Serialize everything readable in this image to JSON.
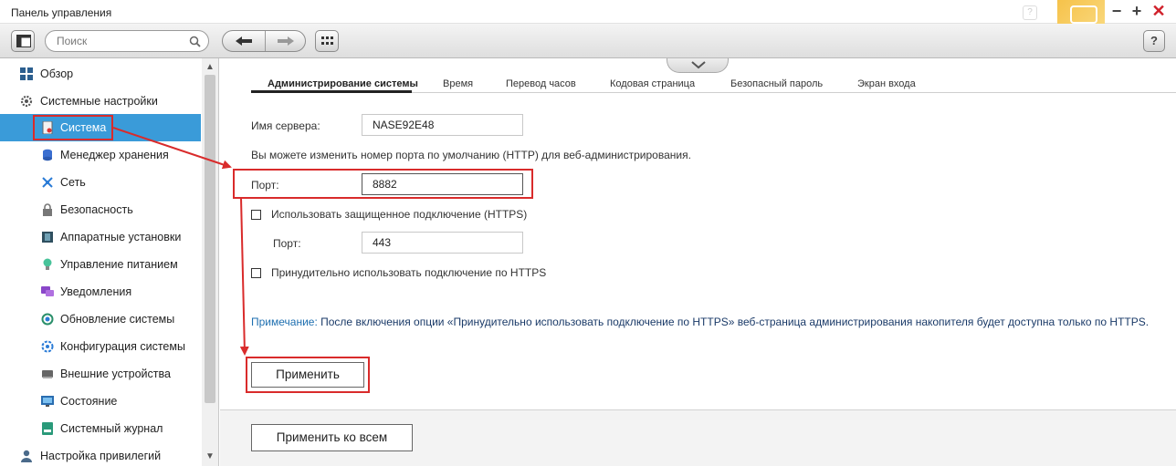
{
  "window": {
    "title": "Панель управления",
    "ghost_help": "?",
    "minimize": "−",
    "maximize": "+",
    "close": "✕"
  },
  "toolbar": {
    "search_placeholder": "Поиск",
    "help": "?"
  },
  "sidebar": {
    "items": [
      {
        "label": "Обзор",
        "icon": "overview-icon",
        "level": "top"
      },
      {
        "label": "Системные настройки",
        "icon": "gear-icon",
        "level": "top"
      },
      {
        "label": "Система",
        "icon": "system-icon",
        "level": "sub",
        "active": true
      },
      {
        "label": "Менеджер хранения",
        "icon": "storage-icon",
        "level": "sub"
      },
      {
        "label": "Сеть",
        "icon": "network-icon",
        "level": "sub"
      },
      {
        "label": "Безопасность",
        "icon": "lock-icon",
        "level": "sub"
      },
      {
        "label": "Аппаратные установки",
        "icon": "hardware-icon",
        "level": "sub"
      },
      {
        "label": "Управление питанием",
        "icon": "power-icon",
        "level": "sub"
      },
      {
        "label": "Уведомления",
        "icon": "notification-icon",
        "level": "sub"
      },
      {
        "label": "Обновление системы",
        "icon": "update-icon",
        "level": "sub"
      },
      {
        "label": "Конфигурация системы",
        "icon": "config-icon",
        "level": "sub"
      },
      {
        "label": "Внешние устройства",
        "icon": "external-device-icon",
        "level": "sub"
      },
      {
        "label": "Состояние",
        "icon": "status-monitor-icon",
        "level": "sub"
      },
      {
        "label": "Системный журнал",
        "icon": "log-icon",
        "level": "sub"
      },
      {
        "label": "Настройка привилегий",
        "icon": "user-icon",
        "level": "top"
      }
    ]
  },
  "tabs": [
    {
      "label": "Администрирование системы",
      "active": true
    },
    {
      "label": "Время"
    },
    {
      "label": "Перевод часов"
    },
    {
      "label": "Кодовая страница"
    },
    {
      "label": "Безопасный пароль"
    },
    {
      "label": "Экран входа"
    }
  ],
  "form": {
    "server_name_label": "Имя сервера:",
    "server_name_value": "NASE92E48",
    "port_hint": "Вы можете изменить номер порта по умолчанию (HTTP) для веб-администрирования.",
    "port_label": "Порт:",
    "port_value": "8882",
    "https_checkbox_label": "Использовать защищенное подключение (HTTPS)",
    "https_checked": false,
    "https_port_label": "Порт:",
    "https_port_value": "443",
    "force_https_label": "Принудительно использовать подключение по HTTPS",
    "force_https_checked": false,
    "note_prefix": "Примечание:",
    "note_text": " После включения опции «Принудительно использовать подключение по HTTPS» веб-страница администрирования накопителя будет доступна только по HTTPS.",
    "apply_button": "Применить",
    "apply_all_button": "Применить ко всем"
  },
  "colors": {
    "active_item": "#3a9bd9",
    "annotation_red": "#d92b2b",
    "note_blue": "#1e6fb0"
  }
}
